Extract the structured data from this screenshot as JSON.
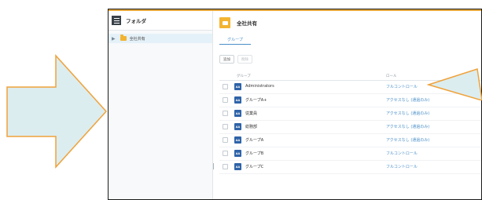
{
  "sidebar": {
    "title": "フォルダ",
    "tree": [
      {
        "label": "全社共有",
        "selected": true
      }
    ]
  },
  "main": {
    "title": "全社共有",
    "tabs": [
      {
        "label": "グループ",
        "active": true
      }
    ],
    "toolbar": {
      "add_label": "追加",
      "remove_label": "削除"
    },
    "table": {
      "columns": {
        "group": "グループ",
        "role": "ロール"
      },
      "rows": [
        {
          "icon": "AA",
          "name": "Administrators",
          "role": "フルコントロール"
        },
        {
          "icon": "AA",
          "name": "グループA+",
          "role": "アクセスなし (通過のみ)"
        },
        {
          "icon": "AA",
          "name": "従業員",
          "role": "アクセスなし (通過のみ)"
        },
        {
          "icon": "AA",
          "name": "総務部",
          "role": "アクセスなし (通過のみ)"
        },
        {
          "icon": "AA",
          "name": "グループA",
          "role": "アクセスなし (通過のみ)"
        },
        {
          "icon": "AA",
          "name": "グループB",
          "role": "フルコントロール"
        },
        {
          "icon": "AA",
          "name": "グループC",
          "role": "フルコントロール"
        }
      ]
    }
  },
  "colors": {
    "accent": "#4a8fc8",
    "folder": "#f2b431",
    "group_icon": "#2e63a8",
    "callout_fill": "#dcedef",
    "callout_stroke": "#f0a23a",
    "selected_row": "#e5f1f8"
  }
}
